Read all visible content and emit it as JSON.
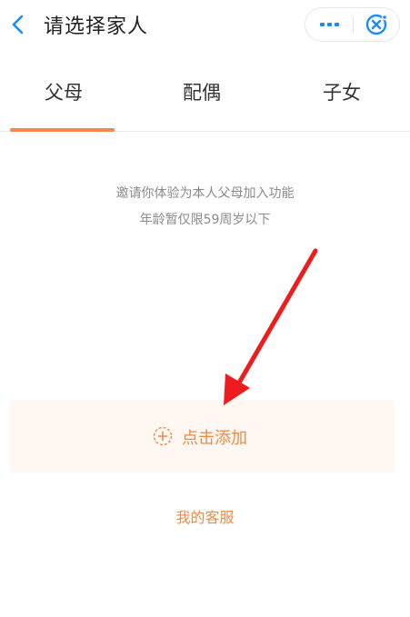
{
  "header": {
    "title": "请选择家人",
    "back_icon": "chevron-left-icon",
    "more_icon": "more-dots-icon",
    "close_icon": "close-circle-icon",
    "accent_color": "#1a8cff"
  },
  "tabs": [
    {
      "label": "父母",
      "active": true
    },
    {
      "label": "配偶",
      "active": false
    },
    {
      "label": "子女",
      "active": false
    }
  ],
  "notice": {
    "line1": "邀请你体验为本人父母加入功能",
    "line2": "年龄暂仅限59周岁以下"
  },
  "add_card": {
    "label": "点击添加",
    "icon": "plus-circle-icon"
  },
  "service_link": "我的客服",
  "colors": {
    "accent_orange": "#ef8a46",
    "card_background": "#fff7f1",
    "annotation_arrow": "#ee1c1c"
  }
}
